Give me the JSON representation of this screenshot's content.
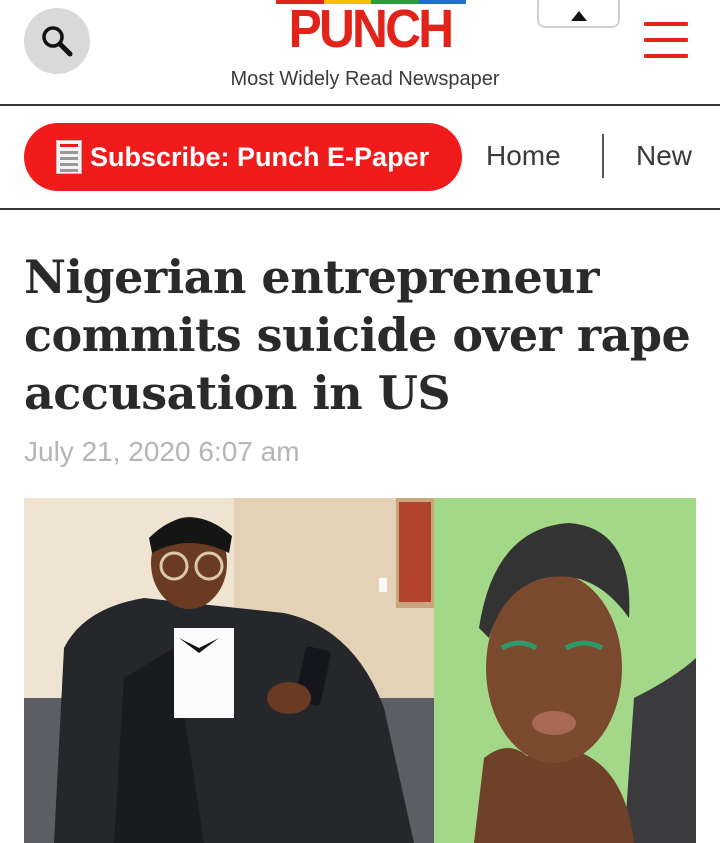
{
  "header": {
    "logo_text": "PUNCH",
    "tagline": "Most Widely Read Newspaper",
    "search_icon": "search-icon",
    "menu_icon": "hamburger-menu-icon",
    "top_box_icon": "caret-up-icon",
    "logo_bar_colors": [
      "#e2231a",
      "#f6c000",
      "#2a9d3a",
      "#1f6fd0"
    ]
  },
  "nav": {
    "subscribe_label": "Subscribe: Punch E-Paper",
    "home_label": "Home",
    "news_label": "New"
  },
  "article": {
    "headline": "Nigerian entrepreneur commits suicide over rape accusation in US",
    "date": "July 21, 2020 6:07 am"
  },
  "colors": {
    "brand_red": "#e2231a",
    "subscribe_red": "#f21b1b",
    "date_gray": "#b5b5b5"
  }
}
